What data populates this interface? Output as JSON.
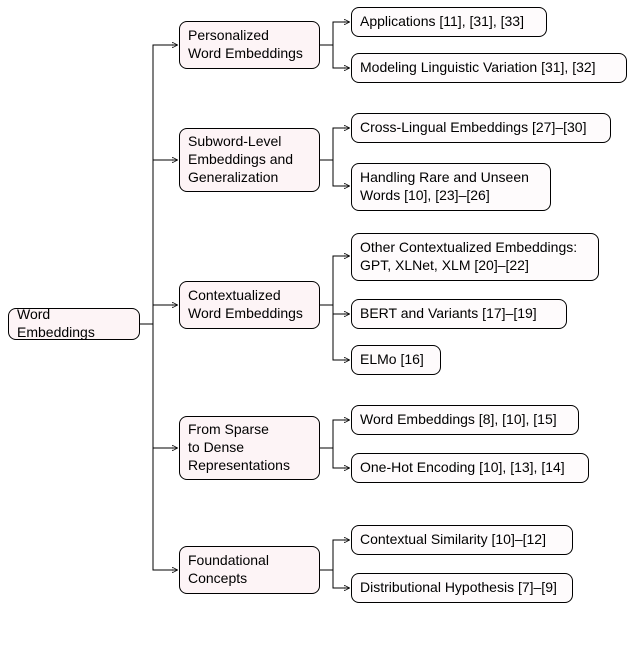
{
  "tree": {
    "root": {
      "label": "Word Embeddings"
    },
    "branches": [
      {
        "label": "Personalized\nWord Embeddings",
        "leaves": [
          {
            "label": "Applications [11], [31], [33]"
          },
          {
            "label": "Modeling Linguistic Variation [31], [32]"
          }
        ]
      },
      {
        "label": "Subword-Level\nEmbeddings and\nGeneralization",
        "leaves": [
          {
            "label": "Cross-Lingual Embeddings [27]–[30]"
          },
          {
            "label": "Handling Rare and Unseen\nWords [10], [23]–[26]"
          }
        ]
      },
      {
        "label": "Contextualized\nWord Embeddings",
        "leaves": [
          {
            "label": "Other Contextualized Embeddings:\nGPT, XLNet, XLM [20]–[22]"
          },
          {
            "label": "BERT and Variants [17]–[19]"
          },
          {
            "label": "ELMo [16]"
          }
        ]
      },
      {
        "label": "From Sparse\nto Dense\nRepresentations",
        "leaves": [
          {
            "label": "Word Embeddings [8], [10], [15]"
          },
          {
            "label": "One-Hot Encoding [10], [13], [14]"
          }
        ]
      },
      {
        "label": "Foundational\nConcepts",
        "leaves": [
          {
            "label": "Contextual Similarity [10]–[12]"
          },
          {
            "label": "Distributional Hypothesis [7]–[9]"
          }
        ]
      }
    ]
  }
}
